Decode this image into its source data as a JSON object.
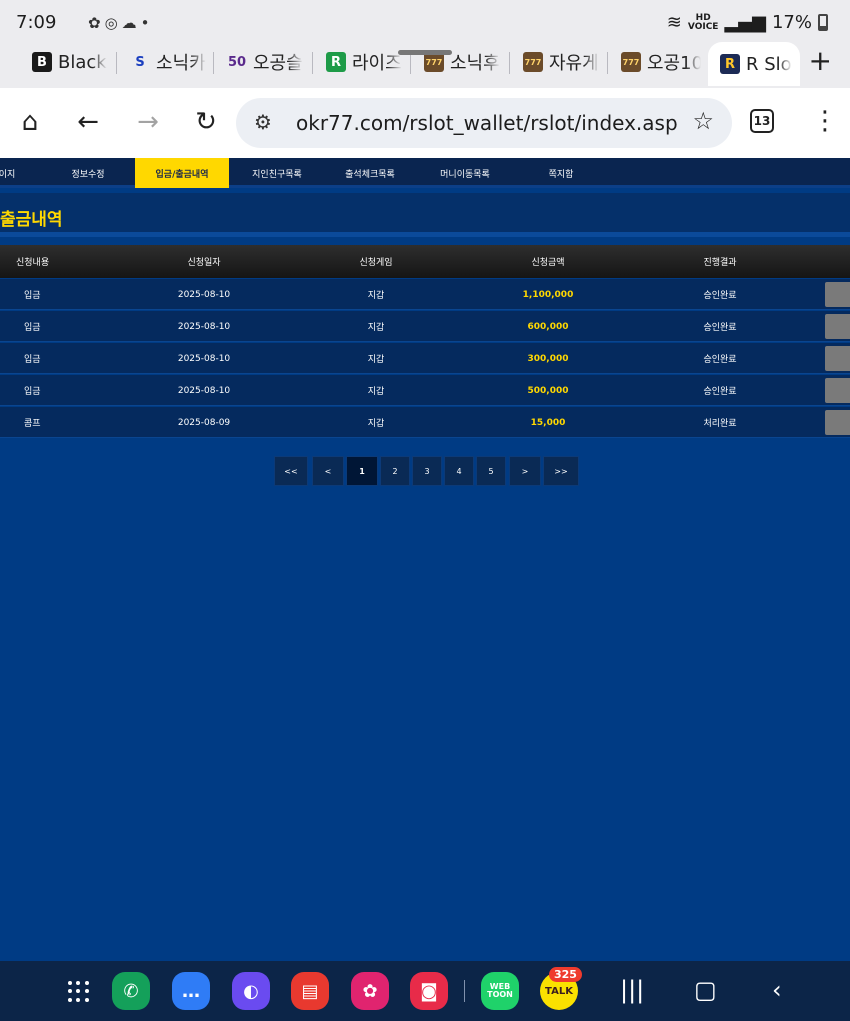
{
  "status_bar": {
    "time": "7:09",
    "battery": "17%",
    "hd_top": "HD",
    "hd_bottom": "VOICE"
  },
  "browser": {
    "tabs": [
      {
        "label": "Black",
        "favicon": "B",
        "favicon_bg": "#1a1a1a",
        "favicon_fg": "#ffffff"
      },
      {
        "label": "소닉카",
        "favicon": "S",
        "favicon_bg": "transparent",
        "favicon_fg": "#1b3fbf"
      },
      {
        "label": "오공슬",
        "favicon": "50",
        "favicon_bg": "transparent",
        "favicon_fg": "#5a2a8c"
      },
      {
        "label": "라이즈",
        "favicon": "R",
        "favicon_bg": "#1e9b48",
        "favicon_fg": "#ffffff"
      },
      {
        "label": "소닉후",
        "favicon": "777",
        "favicon_bg": "#6b4b2a",
        "favicon_fg": "#ffd36a"
      },
      {
        "label": "자유게",
        "favicon": "777",
        "favicon_bg": "#6b4b2a",
        "favicon_fg": "#ffd36a"
      },
      {
        "label": "오공10",
        "favicon": "777",
        "favicon_bg": "#6b4b2a",
        "favicon_fg": "#ffd36a"
      },
      {
        "label": "R Slo",
        "favicon": "R",
        "favicon_bg": "#1c2a55",
        "favicon_fg": "#ffc62a"
      }
    ],
    "url": "okr77.com/rslot_wallet/rslot/index.asp",
    "tab_count": "13"
  },
  "site": {
    "nav": [
      "이지",
      "정보수정",
      "입금/출금내역",
      "지인친구목록",
      "출석체크목록",
      "머니이동목록",
      "쪽지함"
    ],
    "page_title": "출금내역",
    "columns": [
      "신청내용",
      "신청일자",
      "신청게임",
      "신청금액",
      "진행결과"
    ],
    "rows": [
      {
        "type": "입금",
        "date": "2025-08-10",
        "game": "지갑",
        "amount": "1,100,000",
        "result": "승인완료"
      },
      {
        "type": "입금",
        "date": "2025-08-10",
        "game": "지갑",
        "amount": "600,000",
        "result": "승인완료"
      },
      {
        "type": "입금",
        "date": "2025-08-10",
        "game": "지갑",
        "amount": "300,000",
        "result": "승인완료"
      },
      {
        "type": "입금",
        "date": "2025-08-10",
        "game": "지갑",
        "amount": "500,000",
        "result": "승인완료"
      },
      {
        "type": "콤프",
        "date": "2025-08-09",
        "game": "지갑",
        "amount": "15,000",
        "result": "처리완료"
      }
    ],
    "pagination": [
      "<<",
      "<",
      "1",
      "2",
      "3",
      "4",
      "5",
      ">",
      ">>"
    ]
  },
  "dock": {
    "badge": "325",
    "webtoon": "WEB\nTOON",
    "talk": "TALK"
  },
  "colors": {
    "page_bg": "#003b84",
    "accent": "#ffd800",
    "nav_bg": "#0a2550"
  }
}
